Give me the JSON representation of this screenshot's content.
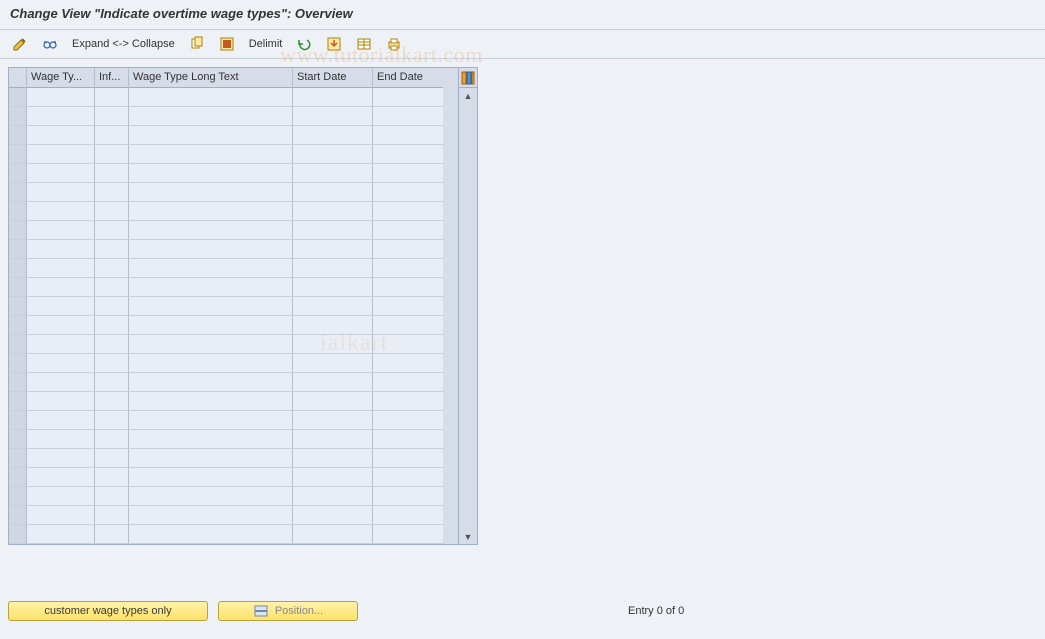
{
  "title": "Change View \"Indicate overtime wage types\": Overview",
  "toolbar": {
    "expand_collapse": "Expand <-> Collapse",
    "delimit": "Delimit"
  },
  "table": {
    "columns": {
      "wage_type": "Wage Ty...",
      "inf": "Inf...",
      "long_text": "Wage Type Long Text",
      "start_date": "Start Date",
      "end_date": "End Date"
    },
    "row_count": 24
  },
  "footer": {
    "customer_btn": "customer wage types only",
    "position_btn": "Position...",
    "entry_text": "Entry 0 of 0"
  },
  "watermark1": "www.tutorialkart.com",
  "watermark2": "ialkart"
}
